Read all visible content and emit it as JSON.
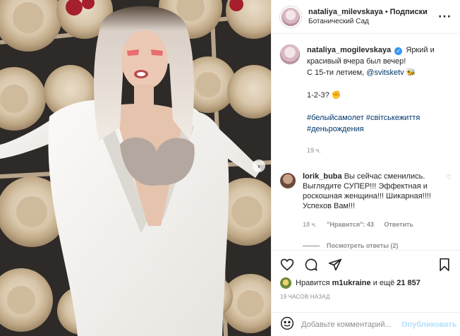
{
  "header": {
    "username": "nataliya_milevskaya",
    "separator": "•",
    "follow_label": "Подписки",
    "location": "Ботанический Сад",
    "more_icon": "more-dots-icon"
  },
  "caption": {
    "username": "nataliya_mogilevskaya",
    "line1": "Яркий и красивый вчера был вечер!",
    "line2_prefix": "С 15-ти летием,",
    "mention": "@svitsketv",
    "line2_emoji": "🐝",
    "line3": "1-2-3? ✊",
    "hashtags_line1": "#белыйсамолет #світськежиття",
    "hashtags_line2": "#деньрождения",
    "time": "19 ч."
  },
  "comment": {
    "username": "lorik_buba",
    "text": "Вы сейчас сменились. Выглядите СУПЕР!!! Эффектная и роскошная женщина!!! Шикарная!!!! Успехов Вам!!!",
    "time": "18 ч.",
    "likes": "\"Нравится\": 43",
    "reply_label": "Ответить",
    "view_replies": "Посмотреть ответы (2)"
  },
  "actions": {
    "like_icon": "heart-icon",
    "comment_icon": "comment-bubble-icon",
    "share_icon": "share-plane-icon",
    "save_icon": "bookmark-icon",
    "likes_prefix": "Нравится",
    "likes_user": "m1ukraine",
    "likes_suffix": "и ещё",
    "likes_count": "21 857",
    "posted_ago": "19 ЧАСОВ НАЗАД"
  },
  "add_comment": {
    "placeholder": "Добавьте комментарий...",
    "publish_label": "Опубликовать",
    "emoji_icon": "smiley-icon"
  },
  "photo": {
    "next_icon": "chevron-right-icon"
  },
  "colors": {
    "link": "#00376b",
    "verified": "#3897f0",
    "muted": "#8e8e8e",
    "publish_disabled": "#b2dffc"
  }
}
